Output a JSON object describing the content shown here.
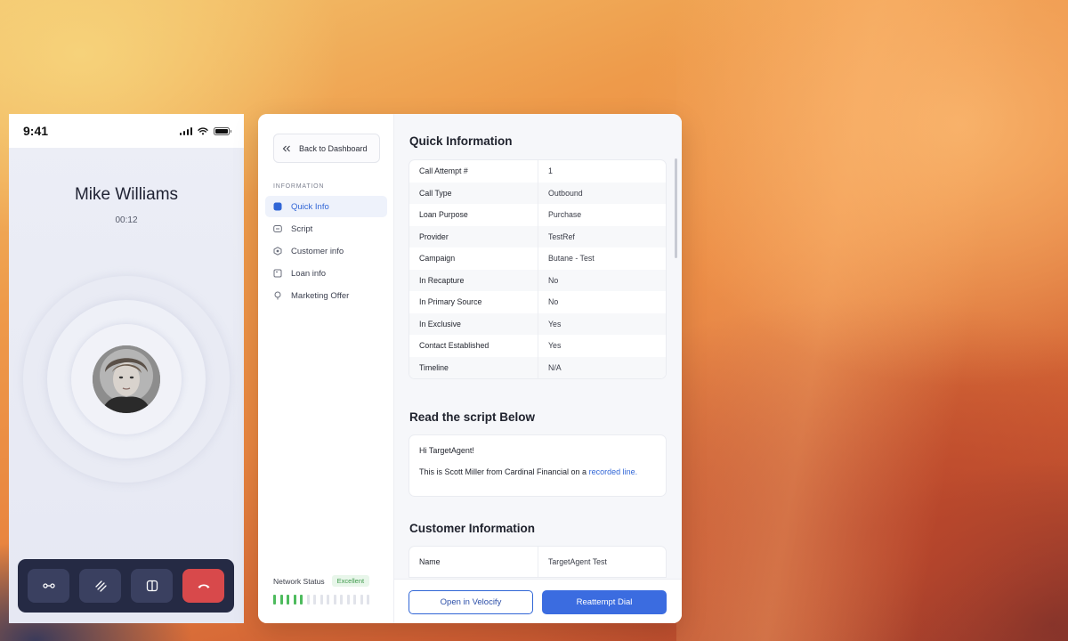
{
  "phone": {
    "time": "9:41",
    "caller_name": "Mike Williams",
    "call_duration": "00:12",
    "controls": [
      {
        "icon": "mute-icon"
      },
      {
        "icon": "keypad-icon"
      },
      {
        "icon": "hold-icon"
      },
      {
        "icon": "end-call-icon",
        "color": "#d8494b"
      }
    ]
  },
  "sidebar": {
    "back_label": "Back to Dashboard",
    "section_title": "INFORMATION",
    "items": [
      {
        "label": "Quick Info",
        "icon": "quick-info-icon",
        "active": true
      },
      {
        "label": "Script",
        "icon": "script-icon"
      },
      {
        "label": "Customer info",
        "icon": "customer-info-icon"
      },
      {
        "label": "Loan info",
        "icon": "loan-info-icon"
      },
      {
        "label": "Marketing Offer",
        "icon": "marketing-offer-icon"
      }
    ],
    "network_label": "Network Status",
    "network_status": "Excellent",
    "network_level": 0.33,
    "accent": "#3166d6"
  },
  "quick_info": {
    "title": "Quick Information",
    "rows": [
      {
        "key": "Call Attempt #",
        "value": "1"
      },
      {
        "key": "Call Type",
        "value": "Outbound"
      },
      {
        "key": "Loan Purpose",
        "value": "Purchase"
      },
      {
        "key": "Provider",
        "value": "TestRef"
      },
      {
        "key": "Campaign",
        "value": "Butane - Test"
      },
      {
        "key": "In Recapture",
        "value": "No"
      },
      {
        "key": "In Primary Source",
        "value": "No"
      },
      {
        "key": "In Exclusive",
        "value": "Yes"
      },
      {
        "key": "Contact Established",
        "value": "Yes"
      },
      {
        "key": "Timeline",
        "value": "N/A"
      }
    ]
  },
  "script": {
    "title": "Read the script Below",
    "greeting": "Hi TargetAgent!",
    "line_text": "This is Scott Miller from Cardinal Financial on a",
    "link_text": "recorded line."
  },
  "customer": {
    "title": "Customer Information",
    "rows": [
      {
        "key": "Name",
        "value": "TargetAgent Test"
      }
    ]
  },
  "footer": {
    "open_label": "Open in Velocify",
    "reattempt_label": "Reattempt Dial",
    "primary_color": "#3b6ce0"
  }
}
